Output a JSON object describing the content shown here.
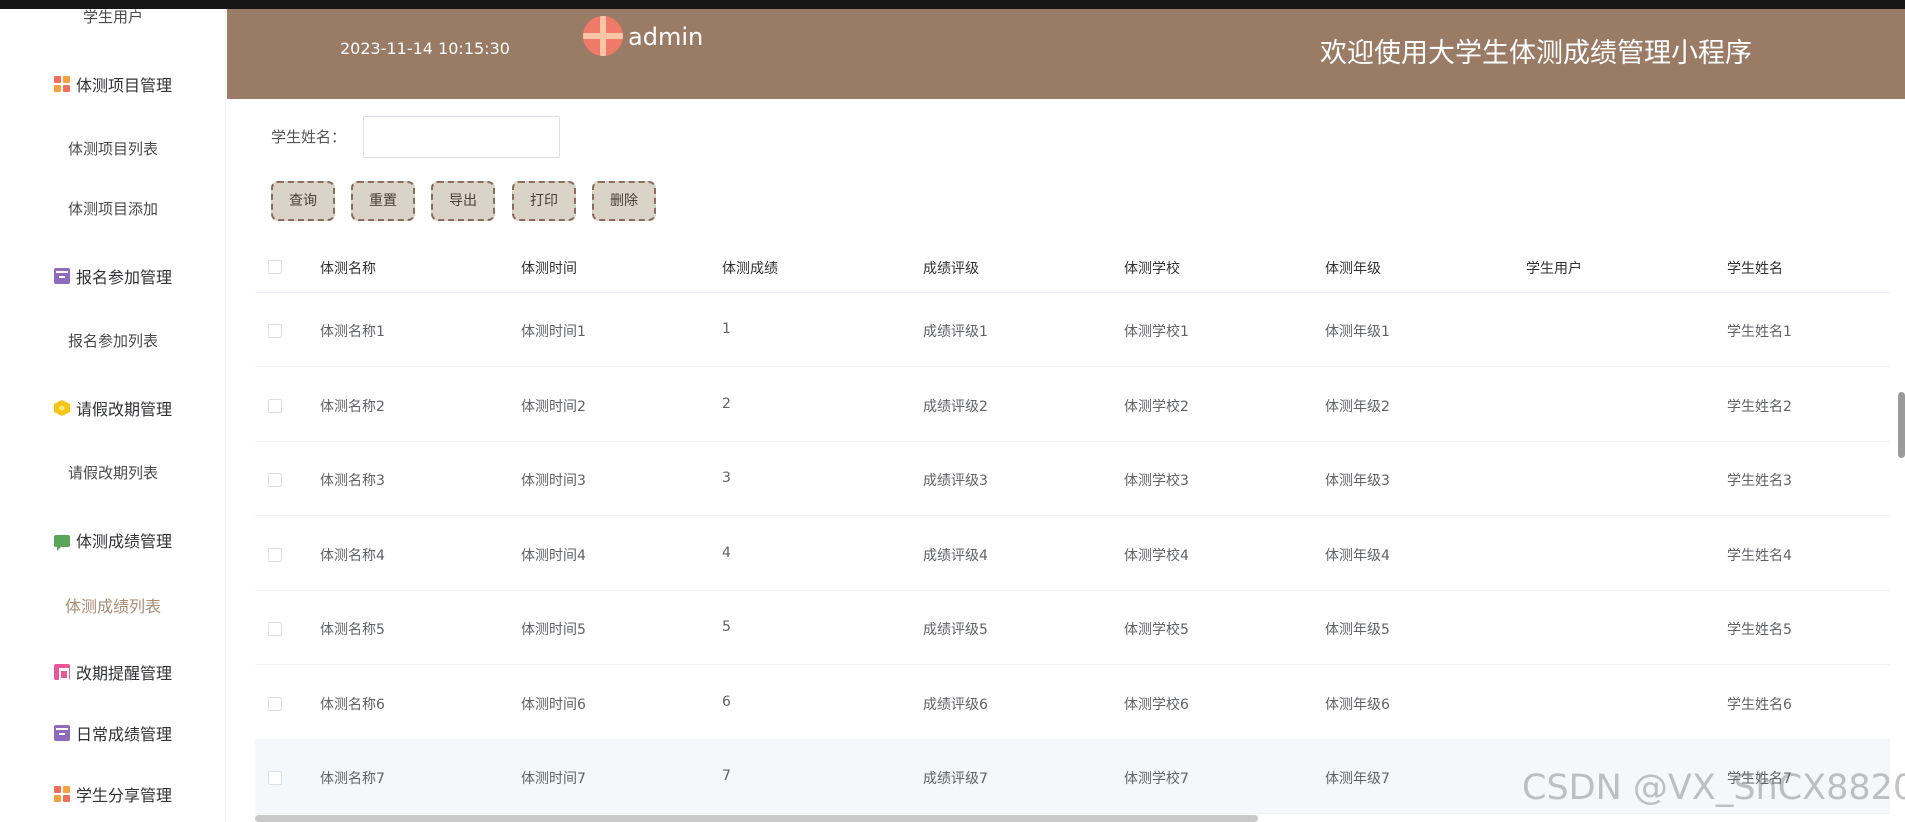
{
  "header": {
    "datetime": "2023-11-14 10:15:30",
    "username": "admin",
    "title": "欢迎使用大学生体测成绩管理小程序"
  },
  "sidebar": {
    "items": [
      {
        "label": "学生用户",
        "type": "sub",
        "icon": null
      },
      {
        "label": "体测项目管理",
        "type": "group",
        "icon": "grid-icon"
      },
      {
        "label": "体测项目列表",
        "type": "sub"
      },
      {
        "label": "体测项目添加",
        "type": "sub"
      },
      {
        "label": "报名参加管理",
        "type": "group",
        "icon": "box-icon"
      },
      {
        "label": "报名参加列表",
        "type": "sub"
      },
      {
        "label": "请假改期管理",
        "type": "group",
        "icon": "hexagon-icon"
      },
      {
        "label": "请假改期列表",
        "type": "sub"
      },
      {
        "label": "体测成绩管理",
        "type": "group",
        "icon": "chat-icon"
      },
      {
        "label": "体测成绩列表",
        "type": "sub",
        "active": true
      },
      {
        "label": "改期提醒管理",
        "type": "group",
        "icon": "home-icon"
      },
      {
        "label": "日常成绩管理",
        "type": "group",
        "icon": "box-icon"
      },
      {
        "label": "学生分享管理",
        "type": "group",
        "icon": "grid-icon"
      }
    ]
  },
  "search": {
    "label": "学生姓名：",
    "value": "",
    "placeholder": ""
  },
  "buttons": {
    "query": "查询",
    "reset": "重置",
    "export": "导出",
    "print": "打印",
    "delete": "删除"
  },
  "table": {
    "columns": [
      "体测名称",
      "体测时间",
      "体测成绩",
      "成绩评级",
      "体测学校",
      "体测年级",
      "学生用户",
      "学生姓名"
    ],
    "rows": [
      [
        "体测名称1",
        "体测时间1",
        "1",
        "成绩评级1",
        "体测学校1",
        "体测年级1",
        "",
        "学生姓名1"
      ],
      [
        "体测名称2",
        "体测时间2",
        "2",
        "成绩评级2",
        "体测学校2",
        "体测年级2",
        "",
        "学生姓名2"
      ],
      [
        "体测名称3",
        "体测时间3",
        "3",
        "成绩评级3",
        "体测学校3",
        "体测年级3",
        "",
        "学生姓名3"
      ],
      [
        "体测名称4",
        "体测时间4",
        "4",
        "成绩评级4",
        "体测学校4",
        "体测年级4",
        "",
        "学生姓名4"
      ],
      [
        "体测名称5",
        "体测时间5",
        "5",
        "成绩评级5",
        "体测学校5",
        "体测年级5",
        "",
        "学生姓名5"
      ],
      [
        "体测名称6",
        "体测时间6",
        "6",
        "成绩评级6",
        "体测学校6",
        "体测年级6",
        "",
        "学生姓名6"
      ],
      [
        "体测名称7",
        "体测时间7",
        "7",
        "成绩评级7",
        "体测学校7",
        "体测年级7",
        "",
        "学生姓名7"
      ]
    ]
  },
  "watermark": "CSDN @VX_ShCX8820",
  "colors": {
    "header_bg": "#9a7c66",
    "button_bg": "#d9d3c8",
    "button_border": "#8a6d5c",
    "active_menu": "#a88d72"
  }
}
